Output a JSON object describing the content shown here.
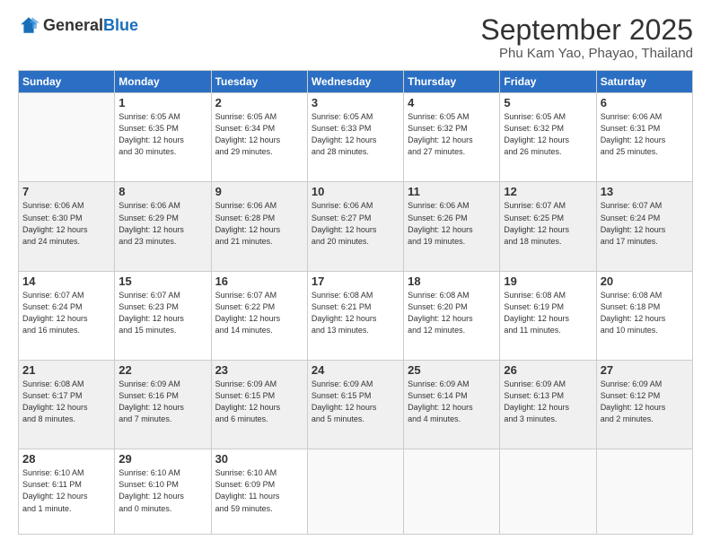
{
  "logo": {
    "text_general": "General",
    "text_blue": "Blue"
  },
  "header": {
    "month_year": "September 2025",
    "location": "Phu Kam Yao, Phayao, Thailand"
  },
  "weekdays": [
    "Sunday",
    "Monday",
    "Tuesday",
    "Wednesday",
    "Thursday",
    "Friday",
    "Saturday"
  ],
  "weeks": [
    [
      {
        "day": "",
        "info": ""
      },
      {
        "day": "1",
        "info": "Sunrise: 6:05 AM\nSunset: 6:35 PM\nDaylight: 12 hours\nand 30 minutes."
      },
      {
        "day": "2",
        "info": "Sunrise: 6:05 AM\nSunset: 6:34 PM\nDaylight: 12 hours\nand 29 minutes."
      },
      {
        "day": "3",
        "info": "Sunrise: 6:05 AM\nSunset: 6:33 PM\nDaylight: 12 hours\nand 28 minutes."
      },
      {
        "day": "4",
        "info": "Sunrise: 6:05 AM\nSunset: 6:32 PM\nDaylight: 12 hours\nand 27 minutes."
      },
      {
        "day": "5",
        "info": "Sunrise: 6:05 AM\nSunset: 6:32 PM\nDaylight: 12 hours\nand 26 minutes."
      },
      {
        "day": "6",
        "info": "Sunrise: 6:06 AM\nSunset: 6:31 PM\nDaylight: 12 hours\nand 25 minutes."
      }
    ],
    [
      {
        "day": "7",
        "info": "Sunrise: 6:06 AM\nSunset: 6:30 PM\nDaylight: 12 hours\nand 24 minutes."
      },
      {
        "day": "8",
        "info": "Sunrise: 6:06 AM\nSunset: 6:29 PM\nDaylight: 12 hours\nand 23 minutes."
      },
      {
        "day": "9",
        "info": "Sunrise: 6:06 AM\nSunset: 6:28 PM\nDaylight: 12 hours\nand 21 minutes."
      },
      {
        "day": "10",
        "info": "Sunrise: 6:06 AM\nSunset: 6:27 PM\nDaylight: 12 hours\nand 20 minutes."
      },
      {
        "day": "11",
        "info": "Sunrise: 6:06 AM\nSunset: 6:26 PM\nDaylight: 12 hours\nand 19 minutes."
      },
      {
        "day": "12",
        "info": "Sunrise: 6:07 AM\nSunset: 6:25 PM\nDaylight: 12 hours\nand 18 minutes."
      },
      {
        "day": "13",
        "info": "Sunrise: 6:07 AM\nSunset: 6:24 PM\nDaylight: 12 hours\nand 17 minutes."
      }
    ],
    [
      {
        "day": "14",
        "info": "Sunrise: 6:07 AM\nSunset: 6:24 PM\nDaylight: 12 hours\nand 16 minutes."
      },
      {
        "day": "15",
        "info": "Sunrise: 6:07 AM\nSunset: 6:23 PM\nDaylight: 12 hours\nand 15 minutes."
      },
      {
        "day": "16",
        "info": "Sunrise: 6:07 AM\nSunset: 6:22 PM\nDaylight: 12 hours\nand 14 minutes."
      },
      {
        "day": "17",
        "info": "Sunrise: 6:08 AM\nSunset: 6:21 PM\nDaylight: 12 hours\nand 13 minutes."
      },
      {
        "day": "18",
        "info": "Sunrise: 6:08 AM\nSunset: 6:20 PM\nDaylight: 12 hours\nand 12 minutes."
      },
      {
        "day": "19",
        "info": "Sunrise: 6:08 AM\nSunset: 6:19 PM\nDaylight: 12 hours\nand 11 minutes."
      },
      {
        "day": "20",
        "info": "Sunrise: 6:08 AM\nSunset: 6:18 PM\nDaylight: 12 hours\nand 10 minutes."
      }
    ],
    [
      {
        "day": "21",
        "info": "Sunrise: 6:08 AM\nSunset: 6:17 PM\nDaylight: 12 hours\nand 8 minutes."
      },
      {
        "day": "22",
        "info": "Sunrise: 6:09 AM\nSunset: 6:16 PM\nDaylight: 12 hours\nand 7 minutes."
      },
      {
        "day": "23",
        "info": "Sunrise: 6:09 AM\nSunset: 6:15 PM\nDaylight: 12 hours\nand 6 minutes."
      },
      {
        "day": "24",
        "info": "Sunrise: 6:09 AM\nSunset: 6:15 PM\nDaylight: 12 hours\nand 5 minutes."
      },
      {
        "day": "25",
        "info": "Sunrise: 6:09 AM\nSunset: 6:14 PM\nDaylight: 12 hours\nand 4 minutes."
      },
      {
        "day": "26",
        "info": "Sunrise: 6:09 AM\nSunset: 6:13 PM\nDaylight: 12 hours\nand 3 minutes."
      },
      {
        "day": "27",
        "info": "Sunrise: 6:09 AM\nSunset: 6:12 PM\nDaylight: 12 hours\nand 2 minutes."
      }
    ],
    [
      {
        "day": "28",
        "info": "Sunrise: 6:10 AM\nSunset: 6:11 PM\nDaylight: 12 hours\nand 1 minute."
      },
      {
        "day": "29",
        "info": "Sunrise: 6:10 AM\nSunset: 6:10 PM\nDaylight: 12 hours\nand 0 minutes."
      },
      {
        "day": "30",
        "info": "Sunrise: 6:10 AM\nSunset: 6:09 PM\nDaylight: 11 hours\nand 59 minutes."
      },
      {
        "day": "",
        "info": ""
      },
      {
        "day": "",
        "info": ""
      },
      {
        "day": "",
        "info": ""
      },
      {
        "day": "",
        "info": ""
      }
    ]
  ]
}
